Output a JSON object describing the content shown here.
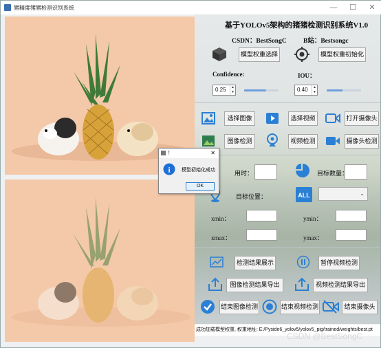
{
  "window": {
    "title": "猪精度猪猪检测识别系统"
  },
  "header": {
    "title": "基于YOLOv5架构的猪猪检测识别系统V1.0",
    "csdn": "CSDN：BestSongC",
    "bilibili": "B站：Bestsongc"
  },
  "model": {
    "select_label": "模型权重选择",
    "init_label": "模型权重初始化"
  },
  "confidence": {
    "label": "Confidence:",
    "value": "0.25",
    "slider_fraction": 0.63
  },
  "iou": {
    "label": "IOU：",
    "value": "0.40",
    "slider_fraction": 0.46
  },
  "sources": {
    "select_image": "选择图像",
    "select_video": "选择视频",
    "open_camera": "打开摄像头",
    "image_detect": "图像检测",
    "video_detect": "视频检测",
    "camera_detect": "摄像头检测"
  },
  "stats": {
    "time_label": "用时：",
    "count_label": "目标数量：",
    "position_label": "目标位置：",
    "xmin_label": "xmin：",
    "ymin_label": "ymin：",
    "xmax_label": "xmax：",
    "ymax_label": "ymax："
  },
  "actions": {
    "show_results": "检测结果展示",
    "pause_video": "暂停视频检测",
    "export_image": "图像检测结果导出",
    "export_video": "视频检测结果导出",
    "end_image": "结束图像检测",
    "end_video": "结束视频检测",
    "end_camera": "结束摄像头"
  },
  "status": {
    "text": "成功加载模型权重, 权重地址: E:/Pyside6_yolov5/yolov5_pig/trained/weights/best.pt"
  },
  "dialog": {
    "title": "！",
    "message": "模型初始化成功",
    "ok": "OK"
  },
  "watermark": "CSDN @BestSongC",
  "colors": {
    "accent": "#2b7fd4",
    "image_bg": "#f4c9a9",
    "slider": "#6c9ede"
  }
}
